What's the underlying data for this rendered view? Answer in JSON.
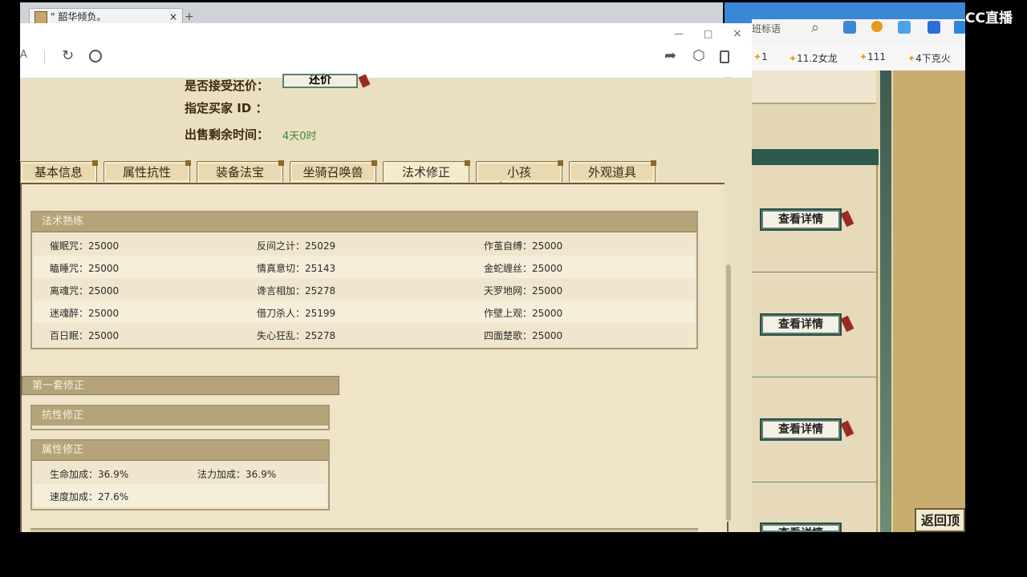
{
  "browser": {
    "tab_title": "\" 韶华倾负。",
    "tab_close": "×",
    "new_tab": "+",
    "popup_controls": {
      "minimize": "—",
      "maximize": "□",
      "close": "×"
    },
    "partial_address_char": "A"
  },
  "right_page": {
    "search_placeholder": "班标语",
    "bookmarks": [
      "1",
      "11.2女龙",
      "111",
      "4下克火"
    ],
    "detail_buttons": [
      "查看详情",
      "查看详情",
      "查看详情",
      "查看详情"
    ],
    "back_to_top": "返回顶"
  },
  "brand": "CC直播",
  "listing": {
    "accept_counter_label": "是否接受还价：",
    "counter_button": "还价",
    "buyer_id_label": "指定买家 ID  ：",
    "time_left_label": "出售剩余时间：",
    "time_left_value": "4天0时"
  },
  "tabs": [
    "基本信息",
    "属性抗性",
    "装备法宝",
    "坐骑召唤兽",
    "法术修正",
    "小孩",
    "外观道具"
  ],
  "spell_mastery": {
    "title": "法术熟练",
    "rows": [
      [
        "催眠咒：25000",
        "反间之计：25029",
        "作茧自缚：25000"
      ],
      [
        "瞌睡咒：25000",
        "情真意切：25143",
        "金蛇缠丝：25000"
      ],
      [
        "离魂咒：25000",
        "谗言相加：25278",
        "天罗地网：25000"
      ],
      [
        "迷魂醉：25000",
        "借刀杀人：25199",
        "作壁上观：25000"
      ],
      [
        "百日眠：25000",
        "失心狂乱：25278",
        "四面楚歌：25000"
      ]
    ]
  },
  "correction_set": {
    "title": "第一套修正",
    "resist_title": "抗性修正",
    "attr_title": "属性修正",
    "attr_rows": [
      [
        "生命加成：36.9%",
        "法力加成：36.9%"
      ],
      [
        "速度加成：27.6%",
        ""
      ]
    ]
  }
}
